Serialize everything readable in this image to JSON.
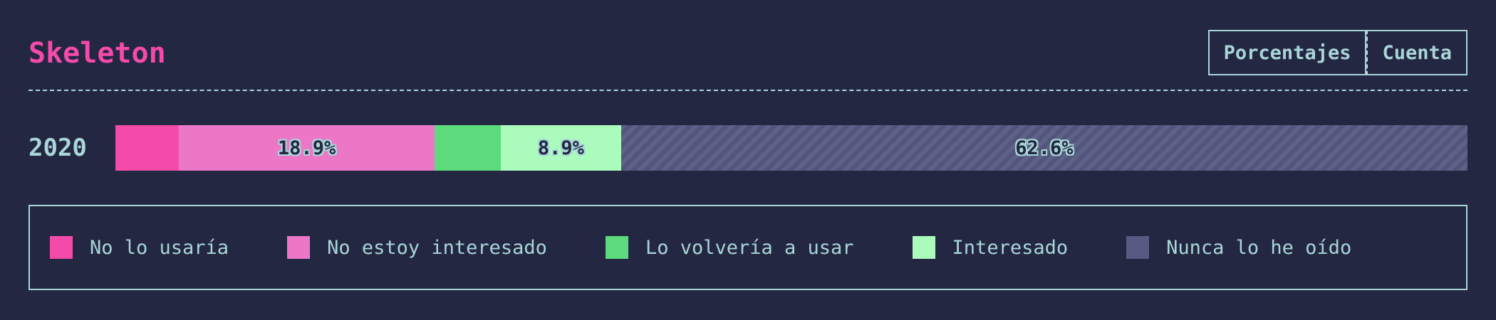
{
  "header": {
    "title": "Skeleton",
    "toggle": {
      "percent_label": "Porcentajes",
      "count_label": "Cuenta",
      "active": "percent"
    }
  },
  "colors": {
    "background": "#232741",
    "text": "#a9d6d8",
    "title": "#f44aa9"
  },
  "chart_data": {
    "type": "bar",
    "orientation": "horizontal",
    "stacked": true,
    "normalized": true,
    "categories": [
      "2020"
    ],
    "series": [
      {
        "name": "No lo usaría",
        "values": [
          4.7
        ],
        "color": "#f44aa9",
        "show_label": false
      },
      {
        "name": "No estoy interesado",
        "values": [
          18.9
        ],
        "color": "#ec77c7",
        "show_label": true
      },
      {
        "name": "Lo volvería a usar",
        "values": [
          4.9
        ],
        "color": "#5bdb7b",
        "show_label": false
      },
      {
        "name": "Interesado",
        "values": [
          8.9
        ],
        "color": "#abfbbd",
        "show_label": true
      },
      {
        "name": "Nunca lo he oído",
        "values": [
          62.6
        ],
        "color": "#575b83",
        "show_label": true,
        "hatched": true
      }
    ],
    "value_labels": [
      "",
      "18.9%",
      "",
      "8.9%",
      "62.6%"
    ],
    "legend_position": "bottom",
    "grid": false
  }
}
